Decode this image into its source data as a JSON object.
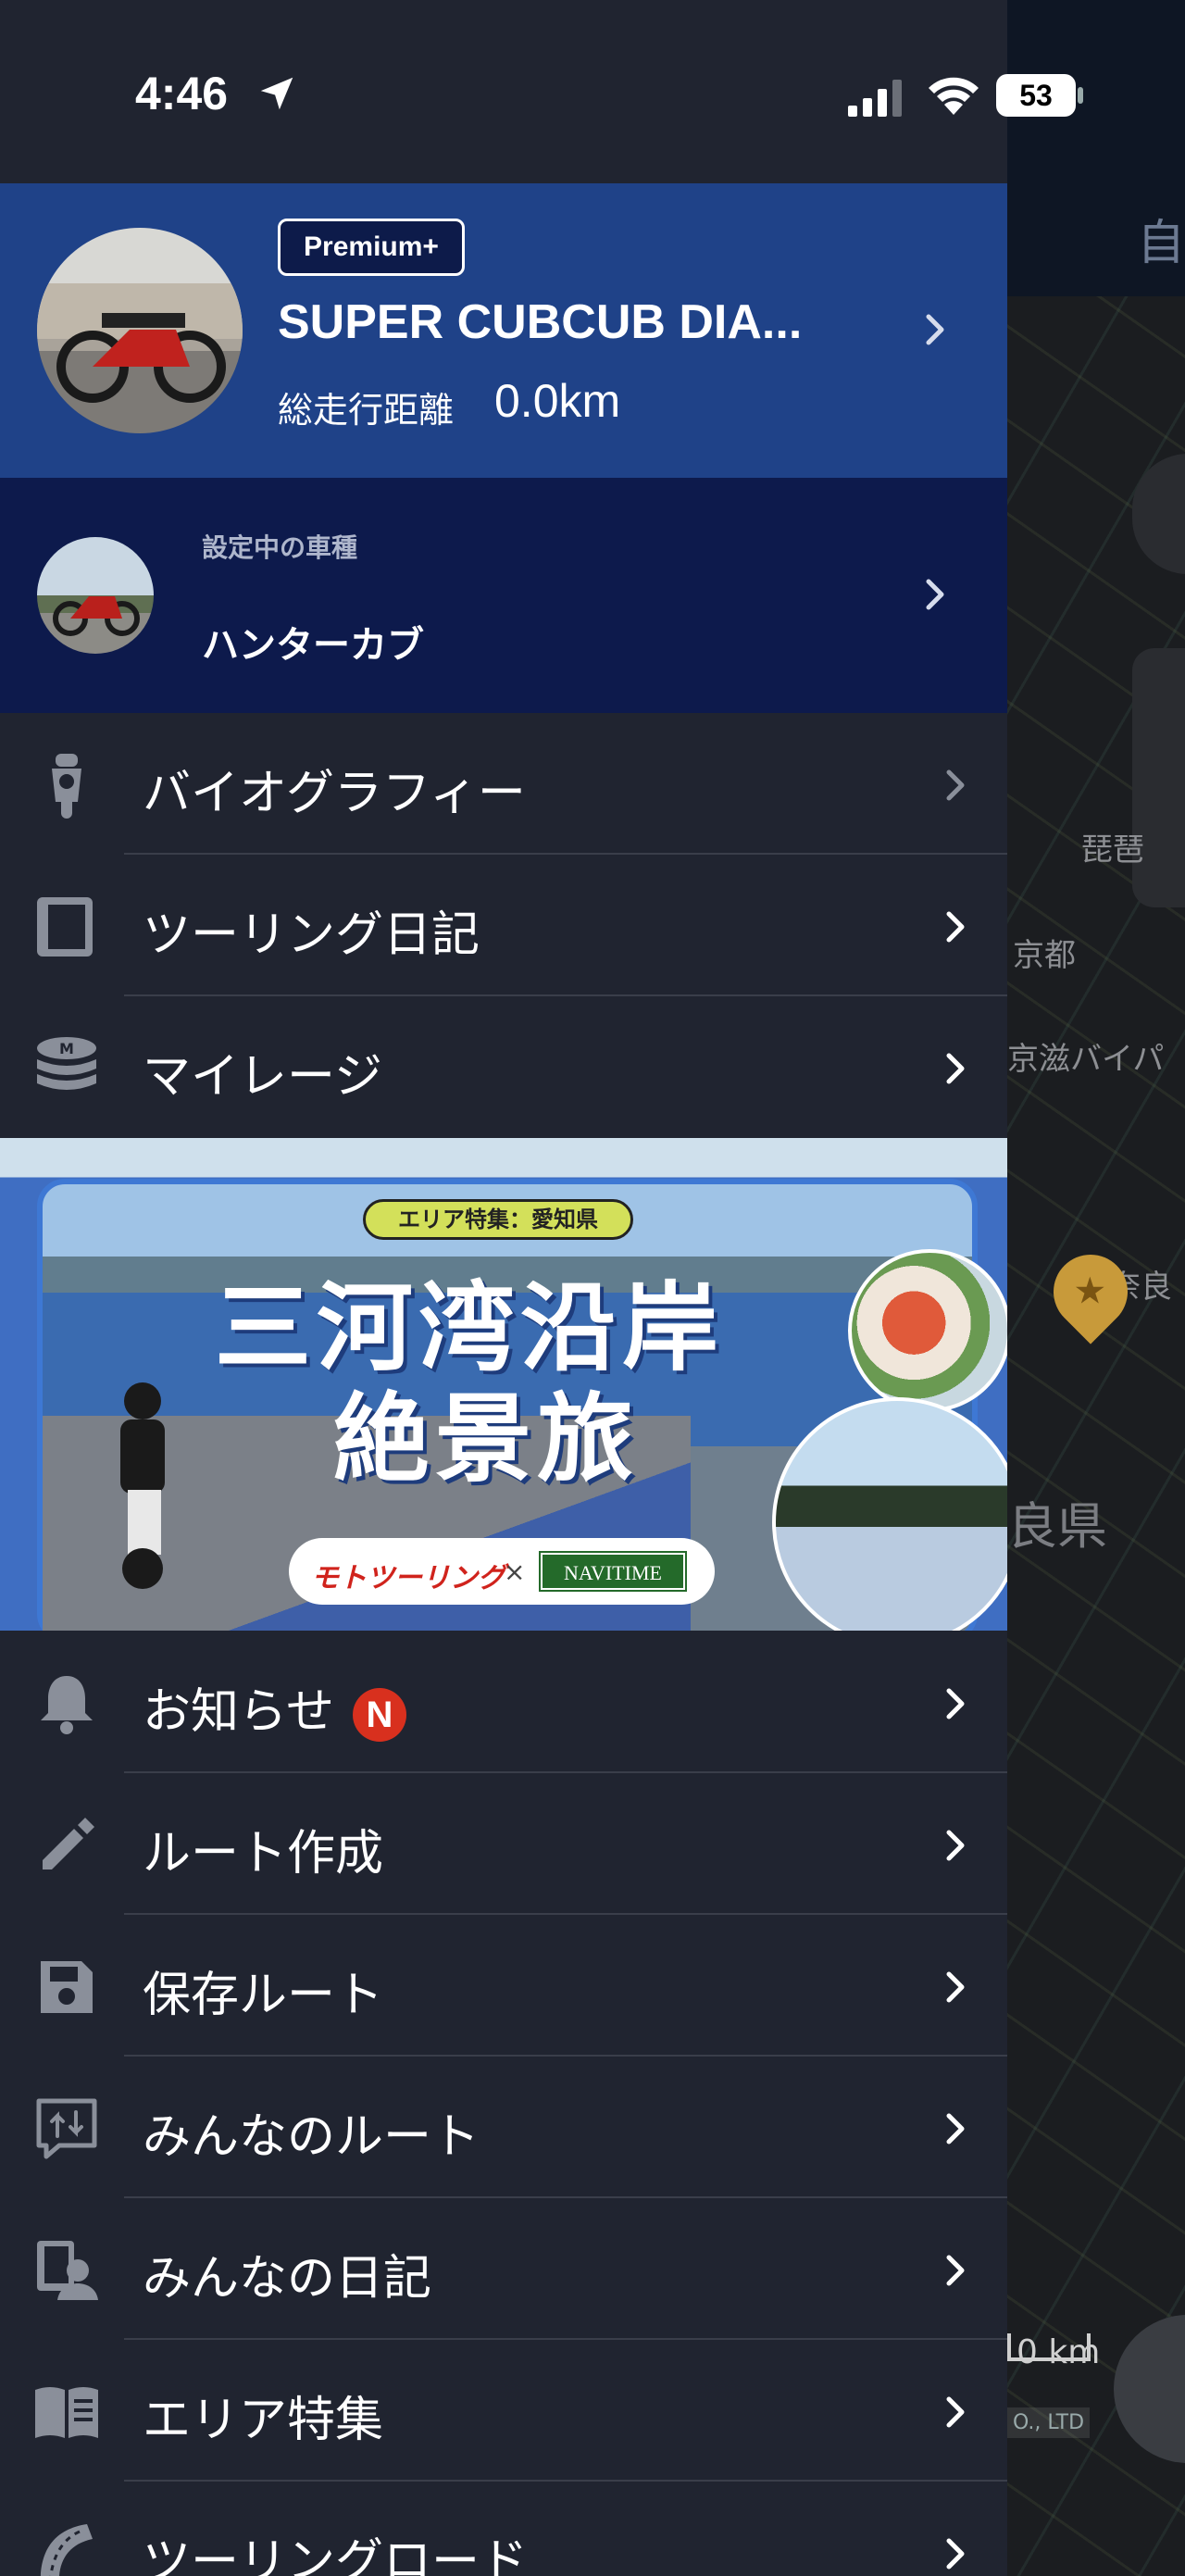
{
  "status_bar": {
    "time": "4:46",
    "battery": "53"
  },
  "profile": {
    "badge": "Premium+",
    "name": "SUPER CUBCUB DIA...",
    "distance_label": "総走行距離",
    "distance_value": "0.0km"
  },
  "vehicle": {
    "label": "設定中の車種",
    "name": "ハンターカブ"
  },
  "menu_top": [
    {
      "label": "バイオグラフィー",
      "icon": "motorcycle-icon"
    },
    {
      "label": "ツーリング日記",
      "icon": "book-icon"
    },
    {
      "label": "マイレージ",
      "icon": "coins-icon"
    }
  ],
  "banner": {
    "tag": "エリア特集：愛知県",
    "title_line1": "三河湾沿岸",
    "title_line2": "絶景旅",
    "logo1": "モトツーリング",
    "cross": "×",
    "logo2": "NAVITIME"
  },
  "menu_bottom": [
    {
      "label": "お知らせ",
      "icon": "bell-icon",
      "badge": "N"
    },
    {
      "label": "ルート作成",
      "icon": "pencil-icon"
    },
    {
      "label": "保存ルート",
      "icon": "save-icon"
    },
    {
      "label": "みんなのルート",
      "icon": "route-share-icon"
    },
    {
      "label": "みんなの日記",
      "icon": "user-diary-icon"
    },
    {
      "label": "エリア特集",
      "icon": "open-book-icon"
    },
    {
      "label": "ツーリングロード",
      "icon": "road-icon"
    }
  ],
  "map": {
    "tab_label": "自",
    "labels": [
      "琵琶",
      "京都",
      "京滋バイパ",
      "奈良",
      "良県"
    ],
    "scale_label": "0 km",
    "credit": "O., LTD"
  },
  "colors": {
    "drawer_bg": "#202430",
    "profile_bg": "#1f4288",
    "vehicle_bg": "#0d1a4c",
    "badge_red": "#d8301e"
  }
}
